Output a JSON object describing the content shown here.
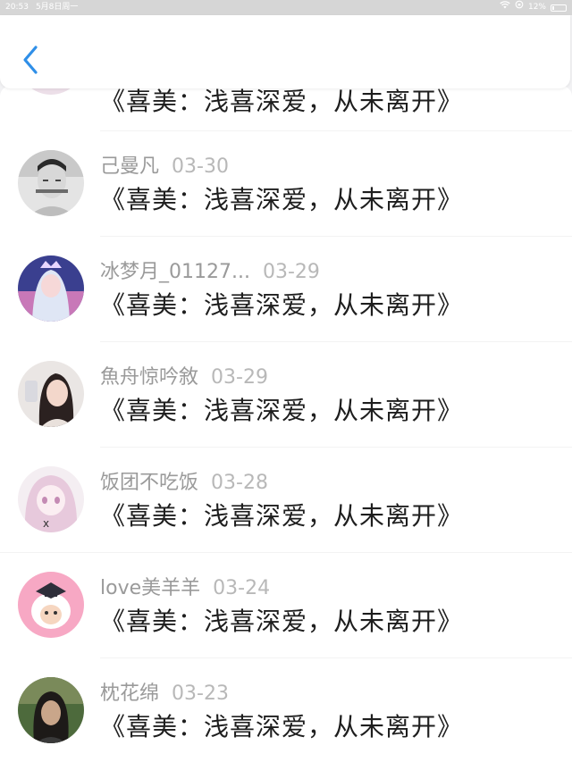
{
  "status_bar": {
    "time": "20:53",
    "date": "5月8日周一",
    "battery": "12%",
    "battery_level": 0.12
  },
  "header": {
    "back_icon": "chevron-left-icon",
    "accent_color": "#2f8fe8"
  },
  "partial_row": {
    "text": "《喜美：浅喜深爱，从未离开》"
  },
  "comments": [
    {
      "name": "己曼凡",
      "date": "03-30",
      "text": "《喜美：浅喜深爱，从未离开》"
    },
    {
      "name": "冰梦月_01127...",
      "date": "03-29",
      "text": "《喜美：浅喜深爱，从未离开》"
    },
    {
      "name": "魚舟惊吟敘",
      "date": "03-29",
      "text": "《喜美：浅喜深爱，从未离开》"
    },
    {
      "name": "饭团不吃饭",
      "date": "03-28",
      "text": "《喜美：浅喜深爱，从未离开》"
    },
    {
      "name": "love美羊羊",
      "date": "03-24",
      "text": "《喜美：浅喜深爱，从未离开》"
    },
    {
      "name": "枕花绵",
      "date": "03-23",
      "text": "《喜美：浅喜深爱，从未离开》"
    }
  ]
}
